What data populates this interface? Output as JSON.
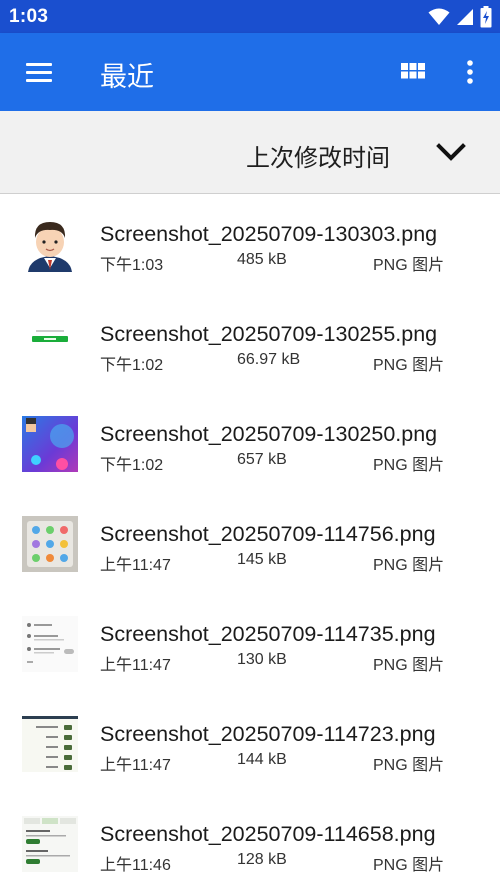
{
  "status_bar": {
    "time": "1:03",
    "icons": [
      "wifi-icon",
      "signal-icon",
      "battery-charging-icon"
    ]
  },
  "app_bar": {
    "title": "最近",
    "menu_icon": "hamburger-menu-icon",
    "view_toggle_icon": "grid-view-icon",
    "overflow_icon": "more-vert-icon",
    "colors": {
      "status_bar": "#1a4fcf",
      "app_bar": "#1f6ee8"
    }
  },
  "sort_bar": {
    "label": "上次修改时间",
    "icon": "chevron-down-icon"
  },
  "files": [
    {
      "name": "Screenshot_20250709-130303.png",
      "date": "下午1:03",
      "size": "485 kB",
      "type": "PNG 图片",
      "thumb": "avatar"
    },
    {
      "name": "Screenshot_20250709-130255.png",
      "date": "下午1:02",
      "size": "66.97 kB",
      "type": "PNG 图片",
      "thumb": "green-button"
    },
    {
      "name": "Screenshot_20250709-130250.png",
      "date": "下午1:02",
      "size": "657 kB",
      "type": "PNG 图片",
      "thumb": "purple-scene"
    },
    {
      "name": "Screenshot_20250709-114756.png",
      "date": "上午11:47",
      "size": "145 kB",
      "type": "PNG 图片",
      "thumb": "icon-grid"
    },
    {
      "name": "Screenshot_20250709-114735.png",
      "date": "上午11:47",
      "size": "130 kB",
      "type": "PNG 图片",
      "thumb": "settings-list"
    },
    {
      "name": "Screenshot_20250709-114723.png",
      "date": "上午11:47",
      "size": "144 kB",
      "type": "PNG 图片",
      "thumb": "toggle-list"
    },
    {
      "name": "Screenshot_20250709-114658.png",
      "date": "上午11:46",
      "size": "128 kB",
      "type": "PNG 图片",
      "thumb": "tabbed-page"
    }
  ]
}
